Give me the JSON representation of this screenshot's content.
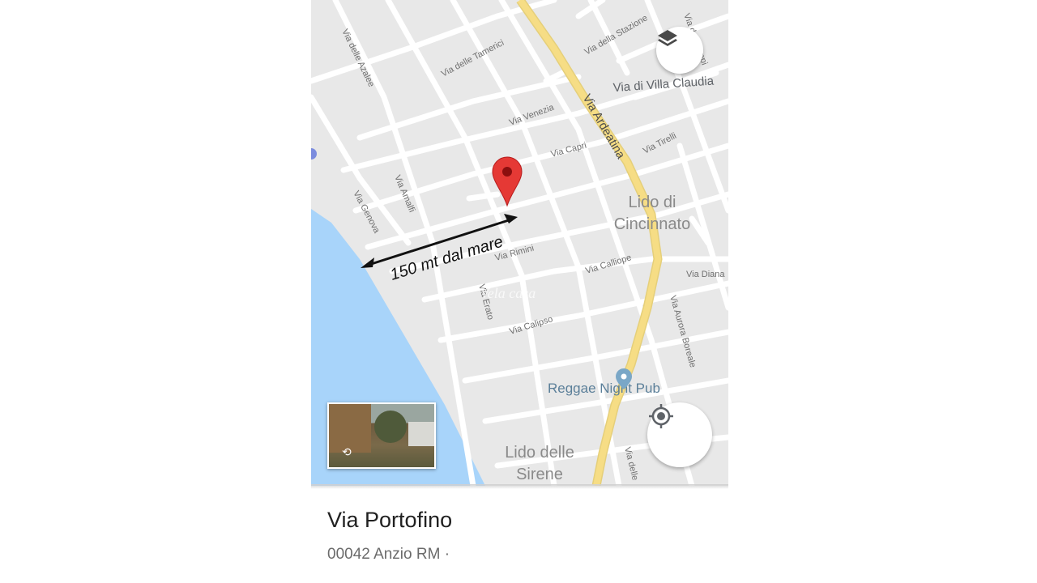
{
  "map": {
    "streets": {
      "azalee": "Via delle Azalee",
      "tamerici": "Via delle Tamerici",
      "stazione": "Via della Stazione",
      "pioppi": "Via dei Pioppi",
      "villa_claudia": "Via di Villa Claudia",
      "ardeatina": "Via Ardeatina",
      "venezia": "Via Venezia",
      "capri": "Via Capri",
      "tirelli": "Via Tirelli",
      "amalfi": "Via Amalfi",
      "genova": "Via Genova",
      "rimini": "Via Rimini",
      "calliope": "Via Calliope",
      "diana": "Via Diana",
      "erato": "Via Erato",
      "calipso": "Via Calipso",
      "aurora_boreale": "Via Aurora Boreale",
      "delle_partial": "Via delle"
    },
    "areas": {
      "lido_cincinnato_1": "Lido di",
      "lido_cincinnato_2": "Cincinnato",
      "lido_sirene_1": "Lido delle",
      "lido_sirene_2": "Sirene"
    },
    "poi": {
      "reggae_pub": "Reggae Night Pub"
    },
    "annotation": {
      "distance": "150 mt dal mare"
    },
    "watermark": "Vela casa",
    "icons": {
      "pin": "map-pin-icon",
      "layers": "layers-icon",
      "locate": "my-location-icon",
      "poi": "poi-pin-icon",
      "rotate": "rotate-360-icon"
    },
    "colors": {
      "land": "#e8e8e8",
      "road": "#ffffff",
      "highway": "#f6dd85",
      "water": "#a8d4fa",
      "pin": "#e53935",
      "poi": "#7aa7c7"
    }
  },
  "place": {
    "title": "Via Portofino",
    "address": "00042 Anzio RM ·"
  }
}
